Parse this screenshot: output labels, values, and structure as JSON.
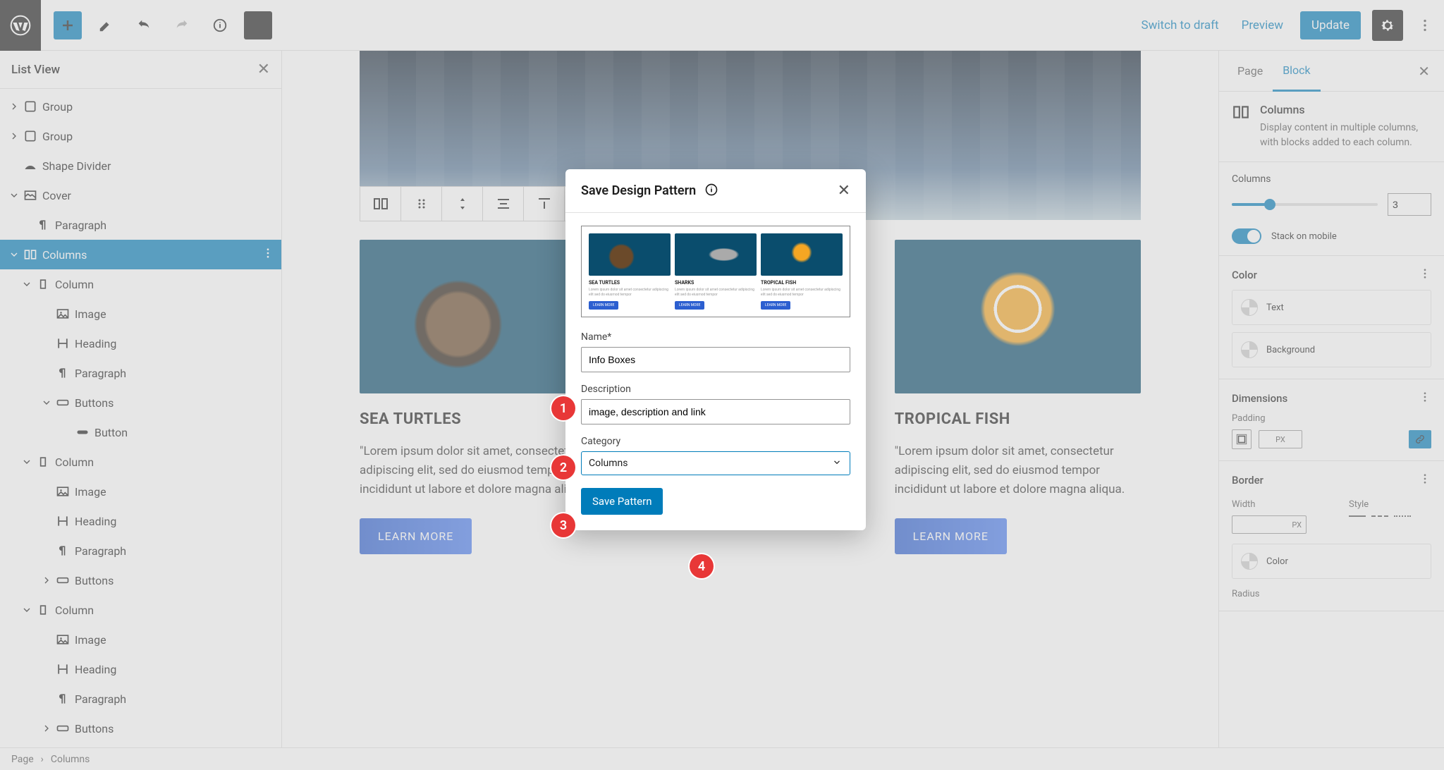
{
  "topbar": {
    "switch_draft": "Switch to draft",
    "preview": "Preview",
    "update": "Update"
  },
  "listview": {
    "title": "List View",
    "items": [
      {
        "label": "Group",
        "icon": "group",
        "indent": 0,
        "chev": "right"
      },
      {
        "label": "Group",
        "icon": "group",
        "indent": 0,
        "chev": "right"
      },
      {
        "label": "Shape Divider",
        "icon": "shape",
        "indent": 0,
        "chev": ""
      },
      {
        "label": "Cover",
        "icon": "cover",
        "indent": 0,
        "chev": "down"
      },
      {
        "label": "Paragraph",
        "icon": "para",
        "indent": 1,
        "chev": ""
      },
      {
        "label": "Columns",
        "icon": "columns",
        "indent": 0,
        "chev": "down",
        "selected": true
      },
      {
        "label": "Column",
        "icon": "column",
        "indent": 1,
        "chev": "down"
      },
      {
        "label": "Image",
        "icon": "image",
        "indent": 2,
        "chev": ""
      },
      {
        "label": "Heading",
        "icon": "heading",
        "indent": 2,
        "chev": ""
      },
      {
        "label": "Paragraph",
        "icon": "para",
        "indent": 2,
        "chev": ""
      },
      {
        "label": "Buttons",
        "icon": "buttons",
        "indent": 2,
        "chev": "down"
      },
      {
        "label": "Button",
        "icon": "button",
        "indent": 3,
        "chev": ""
      },
      {
        "label": "Column",
        "icon": "column",
        "indent": 1,
        "chev": "down"
      },
      {
        "label": "Image",
        "icon": "image",
        "indent": 2,
        "chev": ""
      },
      {
        "label": "Heading",
        "icon": "heading",
        "indent": 2,
        "chev": ""
      },
      {
        "label": "Paragraph",
        "icon": "para",
        "indent": 2,
        "chev": ""
      },
      {
        "label": "Buttons",
        "icon": "buttons",
        "indent": 2,
        "chev": "right"
      },
      {
        "label": "Column",
        "icon": "column",
        "indent": 1,
        "chev": "down"
      },
      {
        "label": "Image",
        "icon": "image",
        "indent": 2,
        "chev": ""
      },
      {
        "label": "Heading",
        "icon": "heading",
        "indent": 2,
        "chev": ""
      },
      {
        "label": "Paragraph",
        "icon": "para",
        "indent": 2,
        "chev": ""
      },
      {
        "label": "Buttons",
        "icon": "buttons",
        "indent": 2,
        "chev": "right"
      }
    ]
  },
  "canvas": {
    "cols": [
      {
        "title": "SEA TURTLES",
        "body": "\"Lorem ipsum dolor sit amet, consectetur adipiscing elit, sed do eiusmod tempor incididunt ut labore et dolore magna aliqua.",
        "btn": "LEARN MORE"
      },
      {
        "title": "",
        "body": "",
        "btn": ""
      },
      {
        "title": "TROPICAL FISH",
        "body": "\"Lorem ipsum dolor sit amet, consectetur adipiscing elit, sed do eiusmod tempor incididunt ut labore et dolore magna aliqua.",
        "btn": "LEARN MORE"
      }
    ]
  },
  "inspector": {
    "tab_page": "Page",
    "tab_block": "Block",
    "block_title": "Columns",
    "block_desc": "Display content in multiple columns, with blocks added to each column.",
    "columns_label": "Columns",
    "columns_val": "3",
    "stack_label": "Stack on mobile",
    "color_title": "Color",
    "color_text": "Text",
    "color_bg": "Background",
    "dim_title": "Dimensions",
    "padding_label": "Padding",
    "px": "PX",
    "border_title": "Border",
    "width_label": "Width",
    "style_label": "Style",
    "border_color": "Color",
    "radius_label": "Radius"
  },
  "footer": {
    "crumb1": "Page",
    "crumb2": "Columns"
  },
  "modal": {
    "title": "Save Design Pattern",
    "name_label": "Name*",
    "name_val": "Info Boxes",
    "desc_label": "Description",
    "desc_val": "image, description and link",
    "cat_label": "Category",
    "cat_val": "Columns",
    "save_btn": "Save Pattern",
    "preview": {
      "t1": "SEA TURTLES",
      "t2": "SHARKS",
      "t3": "TROPICAL FISH",
      "btn": "LEARN MORE",
      "lorem": "Lorem ipsum dolor sit amet consectetur adipiscing elit sed do eiusmod tempor"
    }
  },
  "callouts": [
    "1",
    "2",
    "3",
    "4"
  ]
}
